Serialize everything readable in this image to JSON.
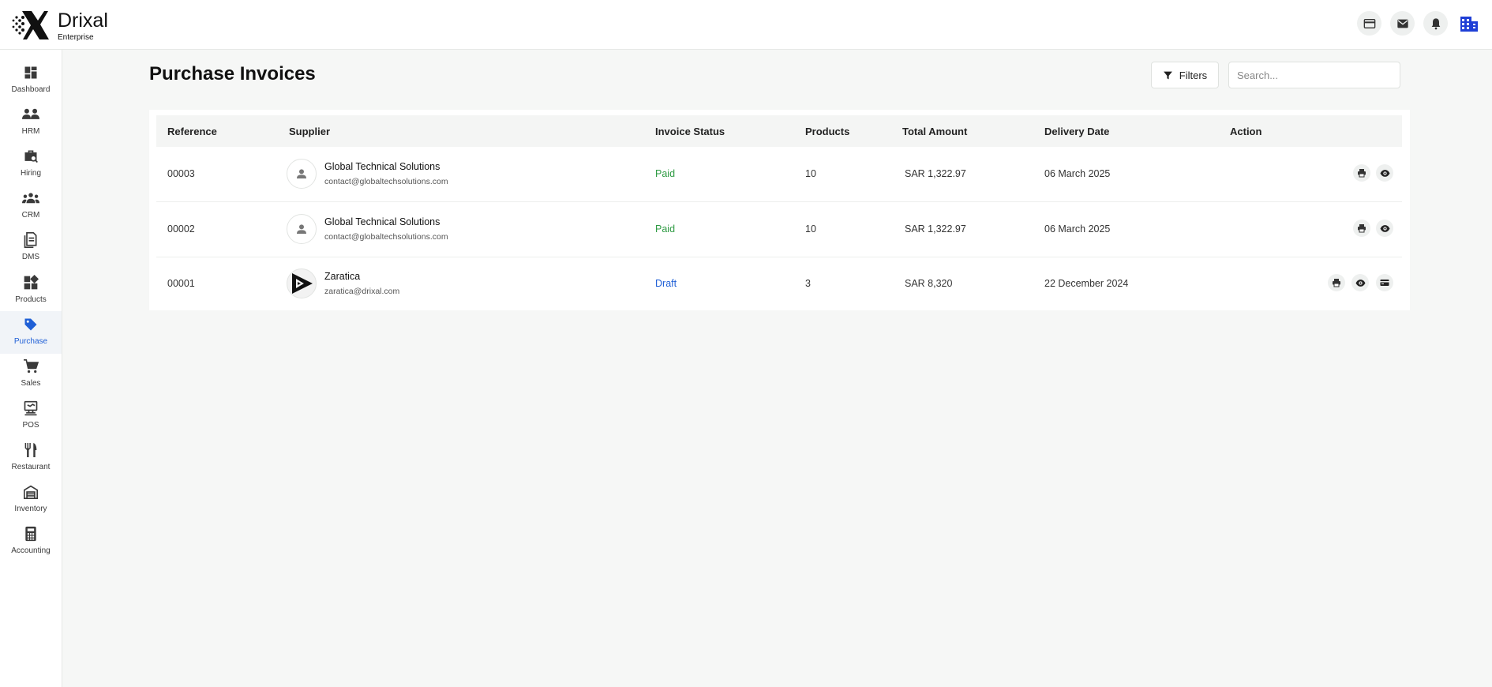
{
  "app": {
    "name": "Drixal",
    "edition": "Enterprise"
  },
  "header_icons": [
    "card-icon",
    "mail-icon",
    "bell-icon",
    "building-icon"
  ],
  "sidebar": {
    "items": [
      {
        "label": "Dashboard",
        "icon": "dashboard-icon",
        "active": false
      },
      {
        "label": "HRM",
        "icon": "people-icon",
        "active": false
      },
      {
        "label": "Hiring",
        "icon": "briefcase-search-icon",
        "active": false
      },
      {
        "label": "CRM",
        "icon": "group-icon",
        "active": false
      },
      {
        "label": "DMS",
        "icon": "document-icon",
        "active": false
      },
      {
        "label": "Products",
        "icon": "widgets-icon",
        "active": false
      },
      {
        "label": "Purchase",
        "icon": "tag-icon",
        "active": true
      },
      {
        "label": "Sales",
        "icon": "cart-icon",
        "active": false
      },
      {
        "label": "POS",
        "icon": "pos-terminal-icon",
        "active": false
      },
      {
        "label": "Restaurant",
        "icon": "utensils-icon",
        "active": false
      },
      {
        "label": "Inventory",
        "icon": "warehouse-icon",
        "active": false
      },
      {
        "label": "Accounting",
        "icon": "calculator-icon",
        "active": false
      }
    ]
  },
  "page": {
    "title": "Purchase Invoices",
    "filters_label": "Filters",
    "search_placeholder": "Search..."
  },
  "table": {
    "columns": [
      "Reference",
      "Supplier",
      "Invoice Status",
      "Products",
      "Total Amount",
      "Delivery Date",
      "Action"
    ],
    "rows": [
      {
        "reference": "00003",
        "supplier_name": "Global Technical Solutions",
        "supplier_email": "contact@globaltechsolutions.com",
        "status": "Paid",
        "products": "10",
        "total": "SAR 1,322.97",
        "delivery_date": "06 March 2025",
        "actions": [
          "print-icon",
          "view-icon"
        ]
      },
      {
        "reference": "00002",
        "supplier_name": "Global Technical Solutions",
        "supplier_email": "contact@globaltechsolutions.com",
        "status": "Paid",
        "products": "10",
        "total": "SAR 1,322.97",
        "delivery_date": "06 March 2025",
        "actions": [
          "print-icon",
          "view-icon"
        ]
      },
      {
        "reference": "00001",
        "supplier_name": "Zaratica",
        "supplier_email": "zaratica@drixal.com",
        "status": "Draft",
        "products": "3",
        "total": "SAR 8,320",
        "delivery_date": "22 December 2024",
        "actions": [
          "print-icon",
          "view-icon",
          "payment-icon"
        ]
      }
    ]
  },
  "colors": {
    "accent": "#1f5fd6",
    "paid": "#2e9b43",
    "draft": "#1f5fd6"
  }
}
